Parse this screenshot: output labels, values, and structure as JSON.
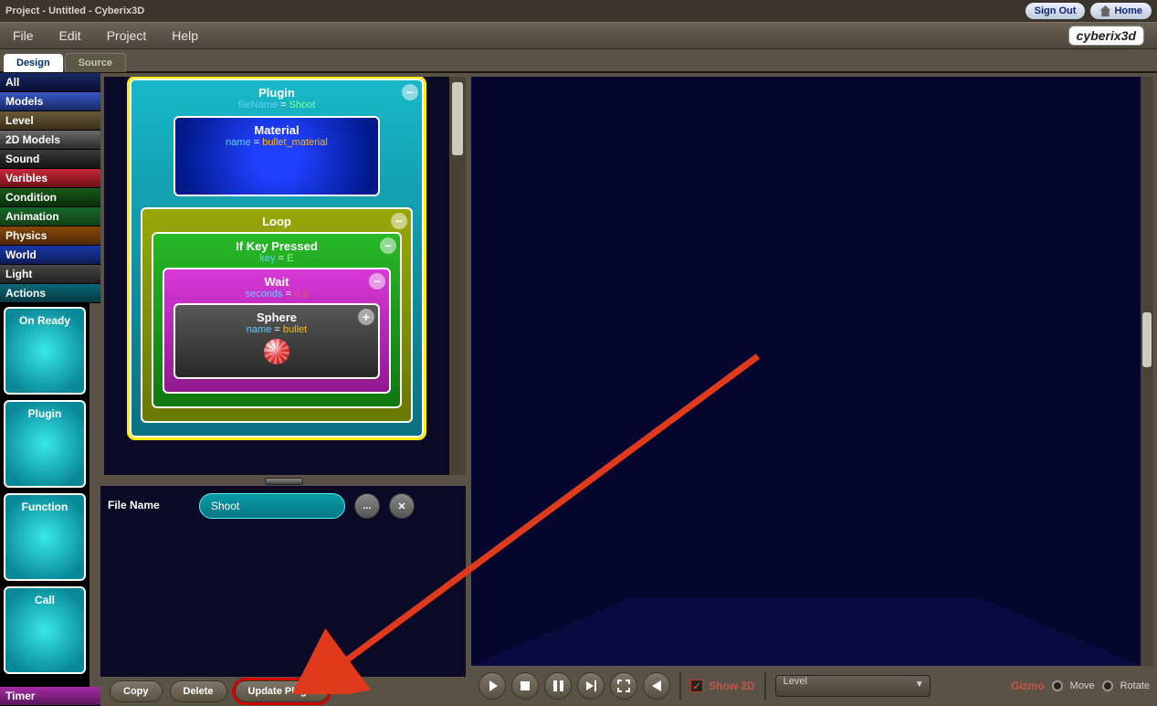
{
  "header": {
    "title": "Project - Untitled - Cyberix3D",
    "signout": "Sign Out",
    "home": "Home"
  },
  "menubar": {
    "items": [
      "File",
      "Edit",
      "Project",
      "Help"
    ],
    "brand": "cyberix3d"
  },
  "tabs": [
    "Design",
    "Source"
  ],
  "categories": [
    "All",
    "Models",
    "Level",
    "2D Models",
    "Sound",
    "Varibles",
    "Condition",
    "Animation",
    "Physics",
    "World",
    "Light",
    "Actions"
  ],
  "cat_bottom": "Timer",
  "palette": [
    "On Ready",
    "Plugin",
    "Function",
    "Call"
  ],
  "blocks": {
    "plugin": {
      "title": "Plugin",
      "k": "fileName",
      "v": "Shoot"
    },
    "material": {
      "title": "Material",
      "k": "name",
      "v": "bullet_material"
    },
    "loop": {
      "title": "Loop"
    },
    "ifkey": {
      "title": "If Key Pressed",
      "k": "key",
      "v": "E"
    },
    "wait": {
      "title": "Wait",
      "k": "seconds",
      "v": "0.3"
    },
    "sphere": {
      "title": "Sphere",
      "k": "name",
      "v": "bullet"
    }
  },
  "props": {
    "label": "File Name",
    "value": "Shoot",
    "dots": "...",
    "x": "✕"
  },
  "actions": {
    "copy": "Copy",
    "delete": "Delete",
    "update": "Update Plugin"
  },
  "transport": {
    "show2d": "Show 2D",
    "dropdown": "Level",
    "gizmo": "Gizmo",
    "move": "Move",
    "rotate": "Rotate"
  }
}
